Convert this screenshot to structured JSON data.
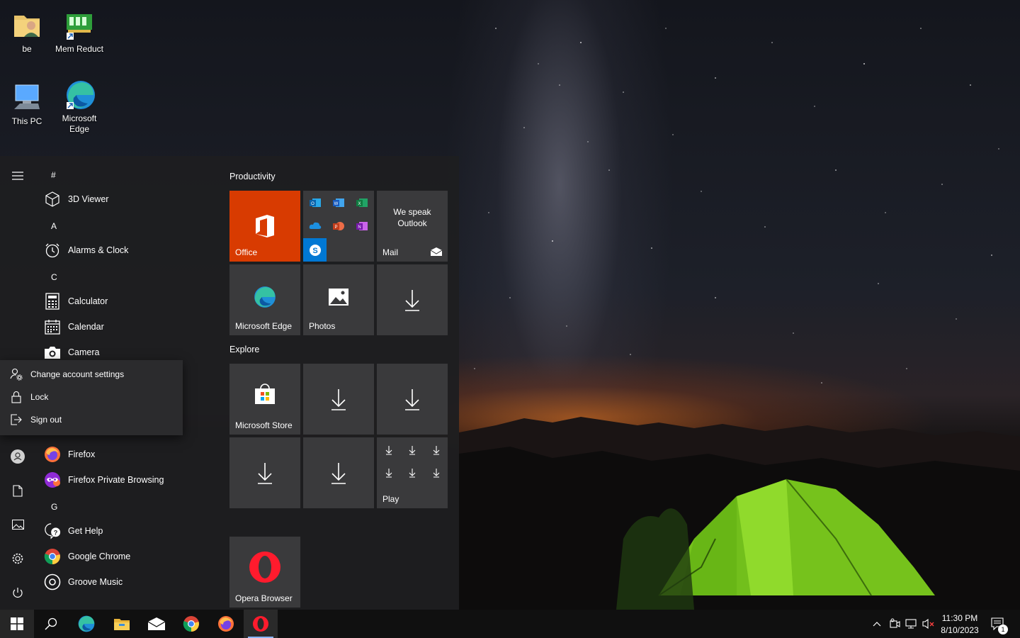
{
  "desktop": {
    "icons": [
      {
        "label": "be",
        "icon": "user-folder-icon"
      },
      {
        "label": "Mem Reduct",
        "icon": "memory-chip-icon"
      },
      {
        "label": "This PC",
        "icon": "computer-icon"
      },
      {
        "label": "Microsoft Edge",
        "icon": "edge-icon"
      }
    ]
  },
  "start_menu": {
    "rail": [
      "hamburger-icon",
      "account-icon",
      "documents-icon",
      "pictures-icon",
      "settings-icon",
      "power-icon"
    ],
    "app_list": {
      "letters": [
        "#",
        "A",
        "C",
        "G"
      ],
      "apps": [
        {
          "label": "3D Viewer",
          "icon": "cube-icon"
        },
        {
          "label": "Alarms & Clock",
          "icon": "alarm-clock-icon"
        },
        {
          "label": "Calculator",
          "icon": "calculator-icon"
        },
        {
          "label": "Calendar",
          "icon": "calendar-icon"
        },
        {
          "label": "Camera",
          "icon": "camera-icon"
        },
        {
          "label": "Firefox",
          "icon": "firefox-icon"
        },
        {
          "label": "Firefox Private Browsing",
          "icon": "firefox-private-icon"
        },
        {
          "label": "Get Help",
          "icon": "help-icon"
        },
        {
          "label": "Google Chrome",
          "icon": "chrome-icon"
        },
        {
          "label": "Groove Music",
          "icon": "music-icon"
        }
      ]
    },
    "account_flyout": {
      "items": [
        {
          "label": "Change account settings",
          "icon": "account-settings-icon"
        },
        {
          "label": "Lock",
          "icon": "lock-icon"
        },
        {
          "label": "Sign out",
          "icon": "sign-out-icon"
        }
      ]
    },
    "groups": [
      {
        "title": "Productivity"
      },
      {
        "title": "Explore"
      }
    ],
    "tiles": {
      "office": {
        "label": "Office",
        "color": "#d83b01"
      },
      "mail": {
        "label": "Mail",
        "text": "We speak Outlook"
      },
      "edge": {
        "label": "Microsoft Edge"
      },
      "photos": {
        "label": "Photos"
      },
      "store": {
        "label": "Microsoft Store"
      },
      "play": {
        "label": "Play"
      },
      "opera": {
        "label": "Opera Browser"
      }
    }
  },
  "taskbar": {
    "buttons": [
      "start-icon",
      "search-icon",
      "edge-icon",
      "file-explorer-icon",
      "mail-icon",
      "chrome-icon",
      "firefox-icon",
      "opera-icon"
    ],
    "tray": [
      "chevron-up-icon",
      "meet-now-icon",
      "network-icon",
      "volume-muted-icon"
    ],
    "time": "11:30 PM",
    "date": "8/10/2023",
    "notifications_count": "1"
  }
}
